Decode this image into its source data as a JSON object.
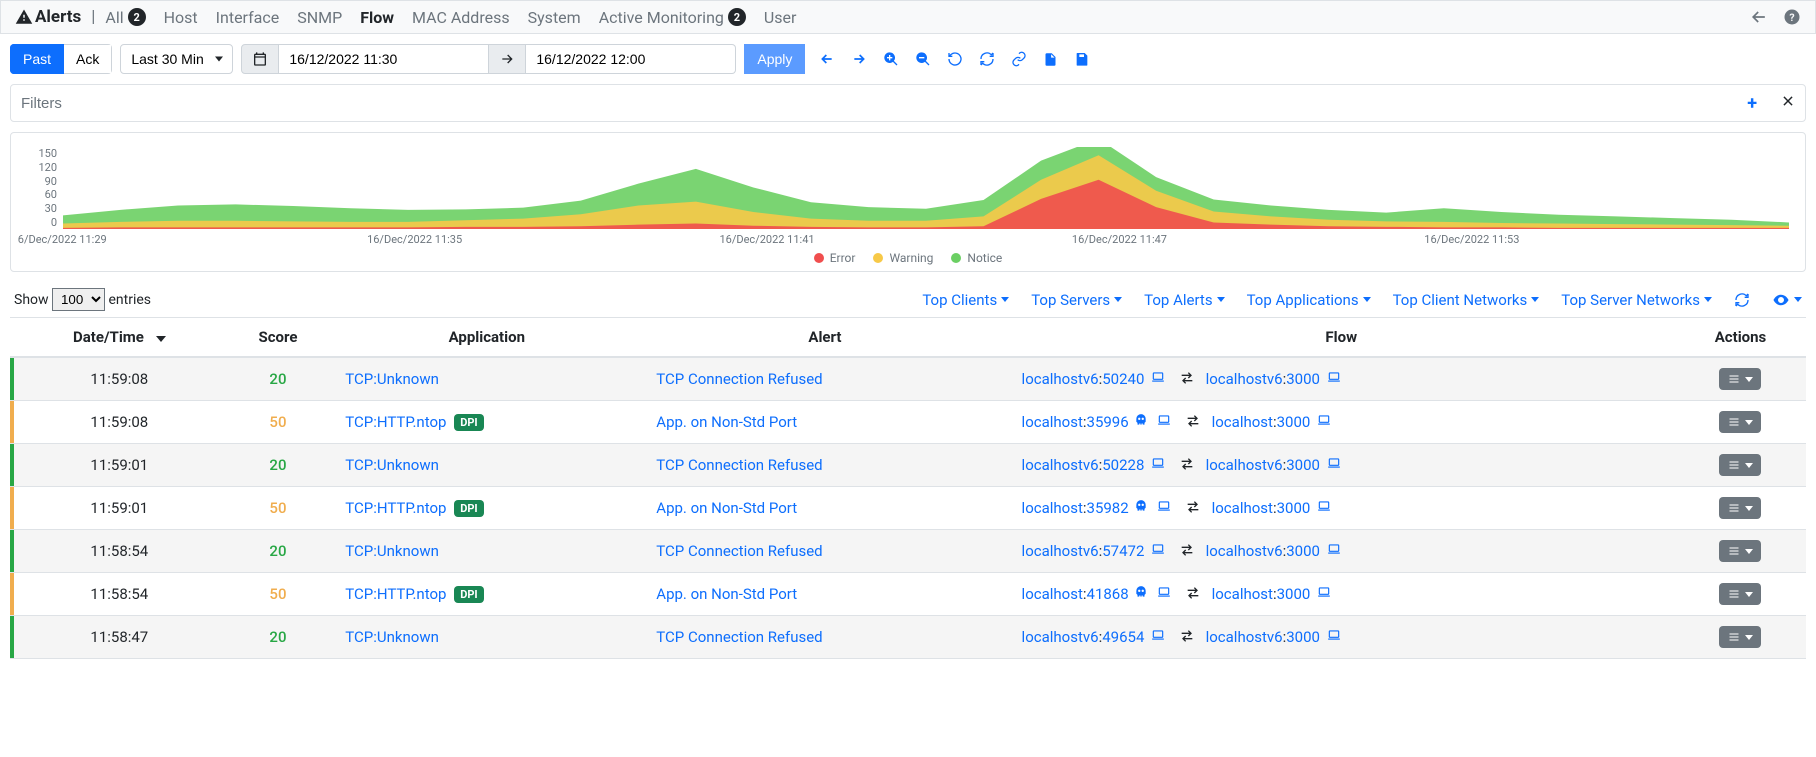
{
  "topbar": {
    "title": "Alerts",
    "tabs": [
      {
        "label": "All",
        "badge": "2"
      },
      {
        "label": "Host"
      },
      {
        "label": "Interface"
      },
      {
        "label": "SNMP"
      },
      {
        "label": "Flow",
        "active": true
      },
      {
        "label": "MAC Address"
      },
      {
        "label": "System"
      },
      {
        "label": "Active Monitoring",
        "badge": "2"
      },
      {
        "label": "User"
      }
    ]
  },
  "toolbar": {
    "past": "Past",
    "ack": "Ack",
    "range_presets_selected": "Last 30 Min",
    "date_from": "16/12/2022 11:30",
    "date_to": "16/12/2022 12:00",
    "apply": "Apply"
  },
  "filters": {
    "placeholder": "Filters"
  },
  "chart_data": {
    "type": "area",
    "x": [
      "11:29",
      "11:30",
      "11:31",
      "11:32",
      "11:33",
      "11:34",
      "11:35",
      "11:36",
      "11:37",
      "11:38",
      "11:39",
      "11:40",
      "11:41",
      "11:42",
      "11:43",
      "11:44",
      "11:45",
      "11:46",
      "11:47",
      "11:48",
      "11:49",
      "11:50",
      "11:51",
      "11:52",
      "11:53",
      "11:54",
      "11:55",
      "11:56",
      "11:57",
      "11:58",
      "11:59"
    ],
    "series": [
      {
        "name": "Error",
        "color": "#f04e4e",
        "values": [
          2,
          3,
          3,
          3,
          3,
          3,
          3,
          4,
          4,
          5,
          8,
          10,
          6,
          4,
          3,
          3,
          5,
          55,
          90,
          40,
          12,
          8,
          5,
          4,
          3,
          3,
          2,
          2,
          2,
          2,
          2
        ]
      },
      {
        "name": "Warning",
        "color": "#f7c948",
        "values": [
          8,
          10,
          12,
          12,
          11,
          10,
          10,
          12,
          15,
          22,
          35,
          40,
          25,
          15,
          12,
          12,
          18,
          35,
          45,
          30,
          20,
          15,
          12,
          10,
          10,
          8,
          8,
          7,
          6,
          5,
          4
        ]
      },
      {
        "name": "Notice",
        "color": "#6bcf63",
        "values": [
          15,
          22,
          28,
          30,
          28,
          25,
          22,
          20,
          20,
          25,
          40,
          60,
          45,
          30,
          25,
          22,
          30,
          35,
          30,
          25,
          22,
          20,
          18,
          16,
          25,
          20,
          16,
          14,
          12,
          10,
          6
        ]
      }
    ],
    "ylim": [
      0,
      150
    ],
    "y_ticks": [
      "150",
      "120",
      "90",
      "60",
      "30",
      "0"
    ],
    "x_ticks": [
      {
        "label": "6/Dec/2022 11:29",
        "pos": 0.02
      },
      {
        "label": "16/Dec/2022 11:35",
        "pos": 0.22
      },
      {
        "label": "16/Dec/2022 11:41",
        "pos": 0.42
      },
      {
        "label": "16/Dec/2022 11:47",
        "pos": 0.62
      },
      {
        "label": "16/Dec/2022 11:53",
        "pos": 0.82
      }
    ],
    "legend": [
      "Error",
      "Warning",
      "Notice"
    ]
  },
  "legend_colors": {
    "Error": "#f04e4e",
    "Warning": "#f7c948",
    "Notice": "#6bcf63"
  },
  "entries": {
    "show": "Show",
    "value": "100",
    "suffix": "entries"
  },
  "top_menus": [
    "Top Clients",
    "Top Servers",
    "Top Alerts",
    "Top Applications",
    "Top Client Networks",
    "Top Server Networks"
  ],
  "columns": [
    "Date/Time",
    "Score",
    "Application",
    "Alert",
    "Flow",
    "Actions"
  ],
  "rows": [
    {
      "sev": "green",
      "time": "11:59:08",
      "score": 20,
      "app": "TCP:Unknown",
      "dpi": false,
      "alert": "TCP Connection Refused",
      "src_host": "localhostv6",
      "src_port": "50240",
      "skull": false,
      "dst_host": "localhostv6",
      "dst_port": "3000"
    },
    {
      "sev": "orange",
      "time": "11:59:08",
      "score": 50,
      "app": "TCP:HTTP.ntop",
      "dpi": true,
      "alert": "App. on Non-Std Port",
      "src_host": "localhost",
      "src_port": "35996",
      "skull": true,
      "dst_host": "localhost",
      "dst_port": "3000"
    },
    {
      "sev": "green",
      "time": "11:59:01",
      "score": 20,
      "app": "TCP:Unknown",
      "dpi": false,
      "alert": "TCP Connection Refused",
      "src_host": "localhostv6",
      "src_port": "50228",
      "skull": false,
      "dst_host": "localhostv6",
      "dst_port": "3000"
    },
    {
      "sev": "orange",
      "time": "11:59:01",
      "score": 50,
      "app": "TCP:HTTP.ntop",
      "dpi": true,
      "alert": "App. on Non-Std Port",
      "src_host": "localhost",
      "src_port": "35982",
      "skull": true,
      "dst_host": "localhost",
      "dst_port": "3000"
    },
    {
      "sev": "green",
      "time": "11:58:54",
      "score": 20,
      "app": "TCP:Unknown",
      "dpi": false,
      "alert": "TCP Connection Refused",
      "src_host": "localhostv6",
      "src_port": "57472",
      "skull": false,
      "dst_host": "localhostv6",
      "dst_port": "3000"
    },
    {
      "sev": "orange",
      "time": "11:58:54",
      "score": 50,
      "app": "TCP:HTTP.ntop",
      "dpi": true,
      "alert": "App. on Non-Std Port",
      "src_host": "localhost",
      "src_port": "41868",
      "skull": true,
      "dst_host": "localhost",
      "dst_port": "3000"
    },
    {
      "sev": "green",
      "time": "11:58:47",
      "score": 20,
      "app": "TCP:Unknown",
      "dpi": false,
      "alert": "TCP Connection Refused",
      "src_host": "localhostv6",
      "src_port": "49654",
      "skull": false,
      "dst_host": "localhostv6",
      "dst_port": "3000"
    }
  ],
  "dpi_badge": "DPI"
}
